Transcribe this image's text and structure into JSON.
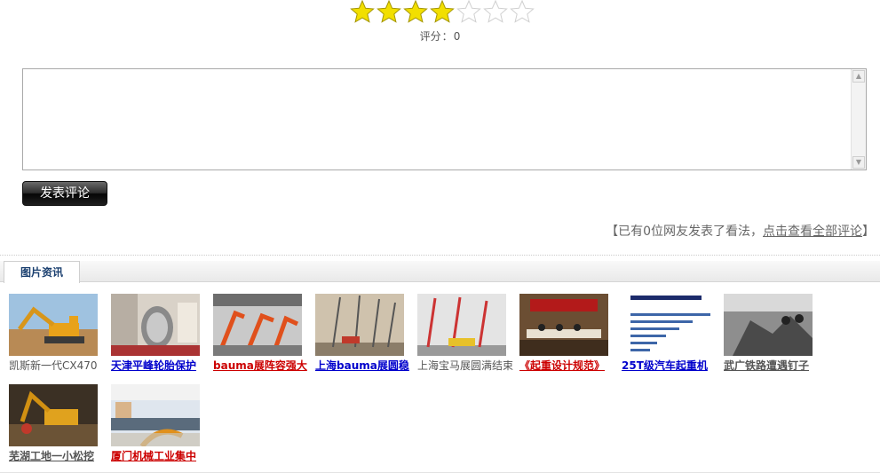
{
  "rating": {
    "stars": [
      {
        "state": "filled"
      },
      {
        "state": "filled"
      },
      {
        "state": "filled"
      },
      {
        "state": "filled"
      },
      {
        "state": "empty"
      },
      {
        "state": "empty"
      },
      {
        "state": "empty"
      }
    ],
    "score_label": "评分",
    "score_sep": "：",
    "score_value": "0"
  },
  "comment": {
    "text": "",
    "submit_label": "发表评论",
    "summary_prefix": "【已有0位网友发表了看法，",
    "summary_link": "点击查看全部评论",
    "summary_suffix": "】"
  },
  "tab": {
    "label": "图片资讯"
  },
  "gallery": [
    {
      "caption": "凯斯新一代CX470",
      "style": "plain",
      "scene": "excavator"
    },
    {
      "caption": "天津平峰轮胎保护",
      "style": "blue",
      "scene": "tire"
    },
    {
      "caption": "bauma展阵容强大",
      "style": "red",
      "scene": "booms"
    },
    {
      "caption": "上海bauma展圆稳",
      "style": "blue",
      "scene": "cranes"
    },
    {
      "caption": "上海宝马展圆满结束",
      "style": "plain",
      "scene": "cranes-red"
    },
    {
      "caption": "《起重设计规范》",
      "style": "red",
      "scene": "meeting"
    },
    {
      "caption": "25T级汽车起重机",
      "style": "blue",
      "scene": "barchart"
    },
    {
      "caption": "武广铁路遭遇钉子",
      "style": "gray",
      "scene": "demolition"
    },
    {
      "caption": "芜湖工地一小松挖",
      "style": "gray",
      "scene": "excavator-dark"
    },
    {
      "caption": "厦门机械工业集中",
      "style": "red",
      "scene": "crowd"
    }
  ],
  "colors": {
    "star_fill": "#f5e100",
    "star_outline": "#d9d9d9",
    "link_blue": "#0000cc",
    "link_red": "#cc0000"
  }
}
